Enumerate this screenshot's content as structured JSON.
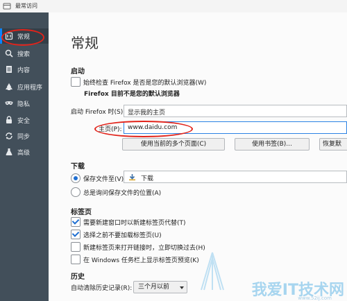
{
  "window": {
    "title": "最常访问"
  },
  "sidebar": {
    "items": [
      {
        "label": "常规",
        "icon": "general-icon",
        "active": true
      },
      {
        "label": "搜索",
        "icon": "search-icon"
      },
      {
        "label": "内容",
        "icon": "content-icon"
      },
      {
        "label": "应用程序",
        "icon": "applications-icon"
      },
      {
        "label": "隐私",
        "icon": "privacy-mask-icon"
      },
      {
        "label": "安全",
        "icon": "lock-icon"
      },
      {
        "label": "同步",
        "icon": "sync-icon"
      },
      {
        "label": "高级",
        "icon": "advanced-icon"
      }
    ]
  },
  "page": {
    "title": "常规"
  },
  "startup": {
    "heading": "启动",
    "default_check_label": "始终检查 Firefox 是否是您的默认浏览器(W)",
    "default_check_checked": false,
    "not_default_text": "Firefox 目前不是您的默认浏览器",
    "when_starts_label": "启动 Firefox 时(S):",
    "when_starts_value": "显示我的主页",
    "homepage_label": "主页(P):",
    "homepage_value": "www.daidu.com",
    "btn_current_pages": "使用当前的多个页面(C)",
    "btn_bookmark": "使用书签(B)...",
    "btn_restore": "恢复默"
  },
  "downloads": {
    "heading": "下载",
    "save_to_label": "保存文件至(V)",
    "save_to_checked": true,
    "folder_value": "下载",
    "always_ask_label": "总是询问保存文件的位置(A)",
    "always_ask_checked": false
  },
  "tabs": {
    "heading": "标签页",
    "items": [
      {
        "label": "需要新建窗口时以新建标签页代替(T)",
        "checked": true
      },
      {
        "label": "选择之前不要加载标签页(U)",
        "checked": true
      },
      {
        "label": "新建标签页来打开链接时，立即切换过去(H)",
        "checked": false
      },
      {
        "label": "在 Windows 任务栏上显示标签页预览(K)",
        "checked": false
      }
    ]
  },
  "history": {
    "heading": "历史",
    "remember_label": "自动清除历史记录(R):",
    "remember_value": "三个月以前"
  },
  "colors": {
    "sidebar_bg": "#424f5a",
    "accent": "#0a84ff",
    "annotation": "#e2231a"
  },
  "watermark": {
    "text": "我爱IT技术网",
    "url": "www.52ij.com"
  }
}
